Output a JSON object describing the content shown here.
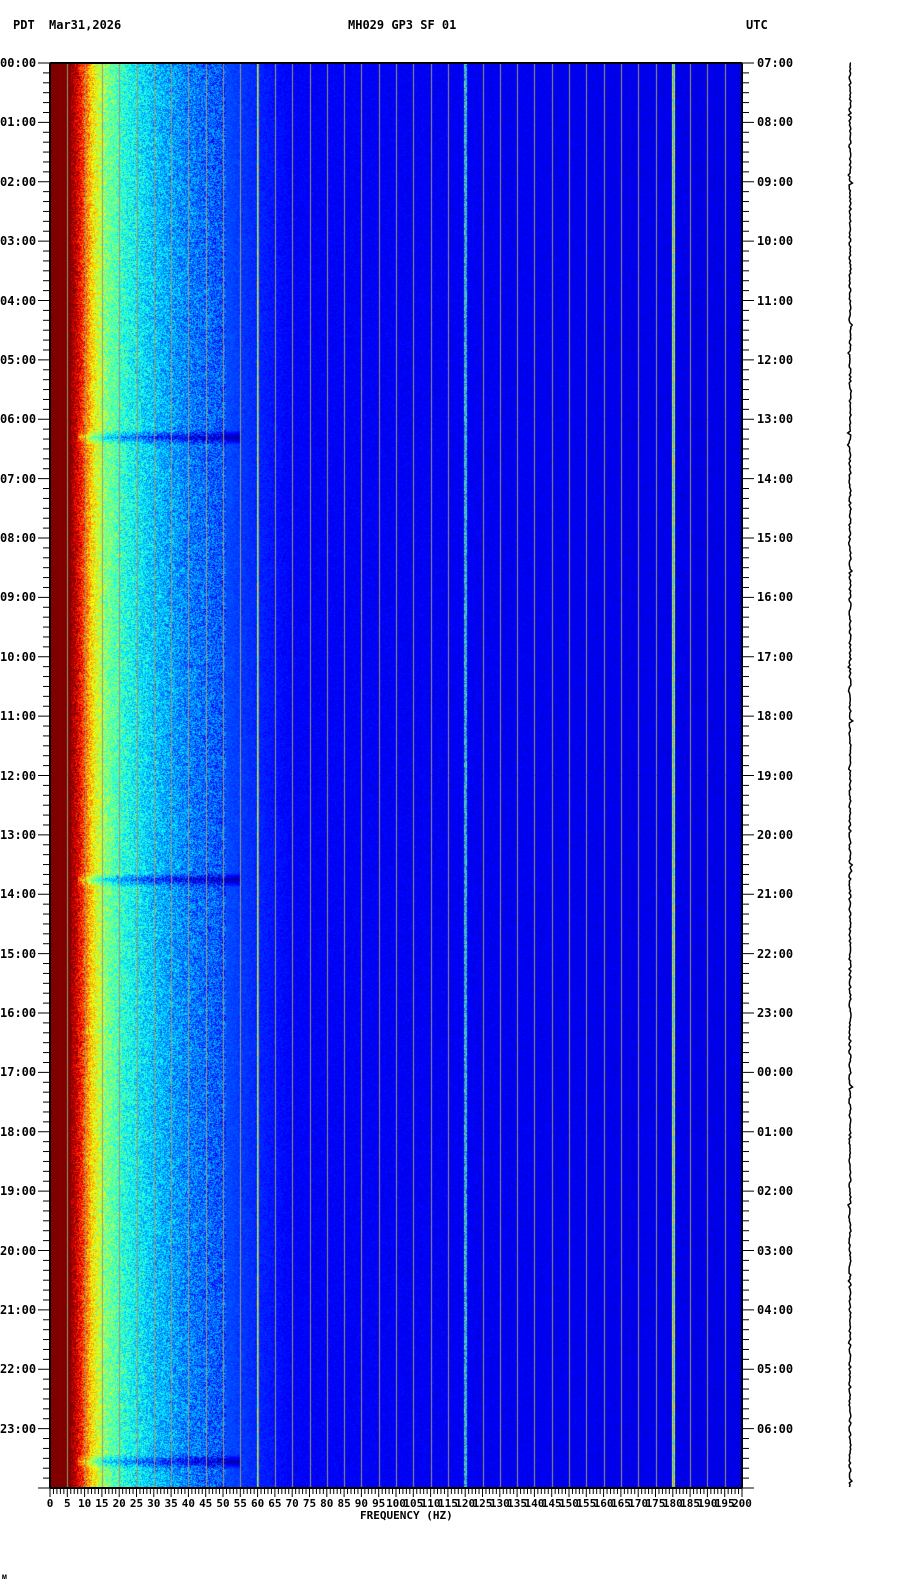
{
  "header": {
    "left_tz": "PDT",
    "date": "Mar31,2026",
    "title": "MH029 GP3 SF 01",
    "right_tz": "UTC"
  },
  "footer_mark": "ᴍ",
  "chart_data": {
    "type": "heatmap",
    "title": "MH029 GP3 SF 01",
    "xlabel": "FREQUENCY (HZ)",
    "xlim": [
      0,
      200
    ],
    "x_ticks": [
      "0",
      "5",
      "10",
      "15",
      "20",
      "25",
      "30",
      "35",
      "40",
      "45",
      "50",
      "55",
      "60",
      "65",
      "70",
      "75",
      "80",
      "85",
      "90",
      "95",
      "100",
      "105",
      "110",
      "115",
      "120",
      "125",
      "130",
      "135",
      "140",
      "145",
      "150",
      "155",
      "160",
      "165",
      "170",
      "175",
      "180",
      "185",
      "190",
      "195",
      "200"
    ],
    "ylim_hours": [
      0,
      24
    ],
    "y_ticks_left_pdt": [
      "00:00",
      "01:00",
      "02:00",
      "03:00",
      "04:00",
      "05:00",
      "06:00",
      "07:00",
      "08:00",
      "09:00",
      "10:00",
      "11:00",
      "12:00",
      "13:00",
      "14:00",
      "15:00",
      "16:00",
      "17:00",
      "18:00",
      "19:00",
      "20:00",
      "21:00",
      "22:00",
      "23:00"
    ],
    "y_ticks_right_utc": [
      "07:00",
      "08:00",
      "09:00",
      "10:00",
      "11:00",
      "12:00",
      "13:00",
      "14:00",
      "15:00",
      "16:00",
      "17:00",
      "18:00",
      "19:00",
      "20:00",
      "21:00",
      "22:00",
      "23:00",
      "00:00",
      "01:00",
      "02:00",
      "03:00",
      "04:00",
      "05:00",
      "06:00"
    ],
    "grid": true,
    "colormap": "jet",
    "intensity_profile": {
      "freq_hz": [
        0,
        6,
        9,
        12,
        16,
        22,
        30,
        40,
        55,
        70,
        200
      ],
      "level": [
        1.0,
        1.0,
        0.85,
        0.65,
        0.5,
        0.4,
        0.32,
        0.25,
        0.18,
        0.12,
        0.1
      ]
    },
    "spectral_lines_hz": [
      60,
      120,
      180
    ],
    "broadband_events_hour": [
      6.3,
      13.75,
      23.55
    ],
    "colors": {
      "grid": "#a09870",
      "background": "#ffffff"
    }
  }
}
